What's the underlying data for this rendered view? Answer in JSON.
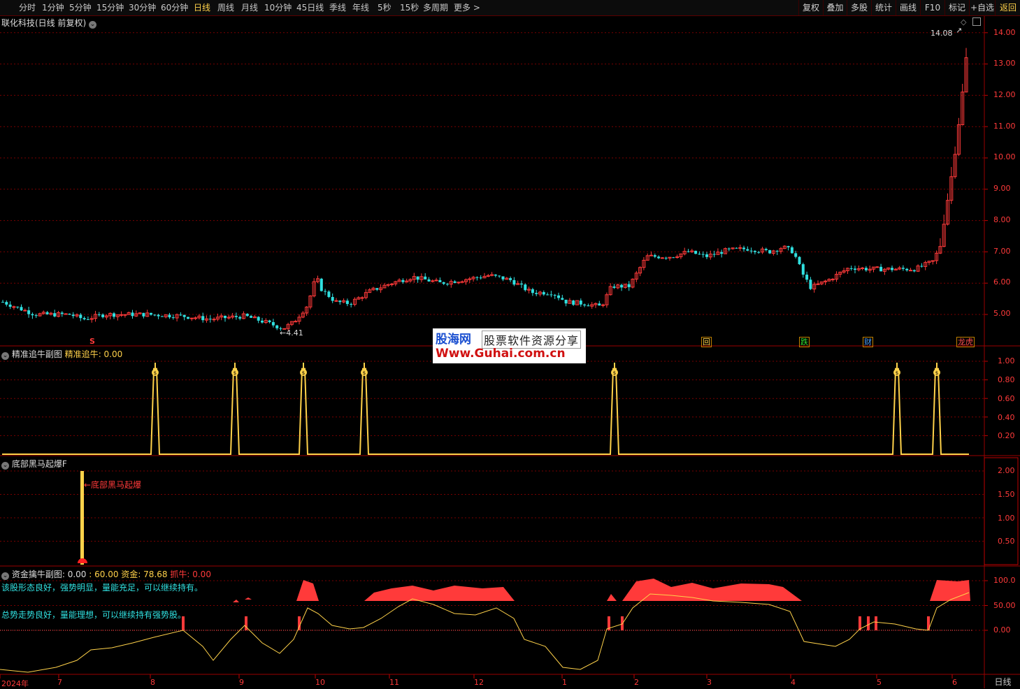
{
  "toolbar": {
    "timeframes": [
      "分时",
      "1分钟",
      "5分钟",
      "15分钟",
      "30分钟",
      "60分钟",
      "日线",
      "周线",
      "月线",
      "10分钟",
      "45日线",
      "季线",
      "年线",
      "5秒",
      "15秒",
      "多周期",
      "更多 >"
    ],
    "active_timeframe": "日线",
    "right_buttons": [
      "复权",
      "叠加",
      "多股",
      "统计",
      "画线",
      "F10",
      "标记",
      "+自选",
      "返回"
    ]
  },
  "main_panel": {
    "title": "联化科技(日线 前复权)",
    "high_label": "14.08",
    "low_label": "4.41",
    "y_ticks": [
      "14.00",
      "13.00",
      "12.00",
      "11.00",
      "10.00",
      "9.00",
      "8.00",
      "7.00",
      "6.00",
      "5.00"
    ],
    "markers": [
      {
        "text": "S",
        "color": "#ff3a3a"
      },
      {
        "text": "回",
        "color": "#ffd24a"
      },
      {
        "text": "跌",
        "color": "#30e030"
      },
      {
        "text": "财",
        "color": "#4aa0ff"
      },
      {
        "text": "龙虎",
        "color": "#ff5050"
      }
    ]
  },
  "panel2": {
    "title": "精准追牛副图",
    "indicator_name": "精准追牛",
    "indicator_value": ": 0.00",
    "y_ticks": [
      "1.00",
      "0.80",
      "0.60",
      "0.40",
      "0.20"
    ]
  },
  "panel3": {
    "title": "底部黑马起爆F",
    "annotation": "←底部黑马起爆",
    "y_ticks": [
      "2.00",
      "1.50",
      "1.00",
      "0.50"
    ]
  },
  "panel4": {
    "title": "资金擒牛副图",
    "val1": ": 0.00",
    "val2": ": 60.00",
    "fund_label": "资金",
    "fund_value": ": 78.68",
    "catch_label": "抓牛",
    "catch_value": ": 0.00",
    "comment1": "该股形态良好，强势明显，量能充足，可以继续持有。",
    "comment2": "总势走势良好，量能理想，可以继续持有强势股。",
    "y_ticks": [
      "100.0",
      "50.00",
      "0.00"
    ]
  },
  "x_axis": {
    "labels": [
      "2024年",
      "7",
      "8",
      "9",
      "10",
      "11",
      "12",
      "1",
      "2",
      "3",
      "4",
      "5",
      "6"
    ],
    "period": "日线"
  },
  "watermark": {
    "brand": "股海网",
    "slogan": "股票软件资源分享",
    "url": "Www.Guhai.com.cn"
  },
  "colors": {
    "up": "#ff3a3a",
    "down": "#30e0e0",
    "signal": "#ffd24a",
    "grid": "#7a0000"
  }
}
